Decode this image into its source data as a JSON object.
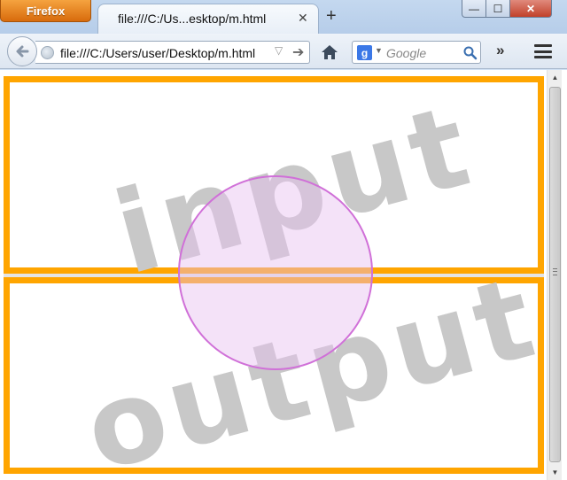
{
  "window": {
    "app_button_label": "Firefox",
    "tab_title": "file:///C:/Us...esktop/m.html",
    "tab_close_icon": "close-icon",
    "new_tab_label": "+",
    "controls": {
      "minimize": "—",
      "maximize": "☐",
      "close": "✕"
    }
  },
  "toolbar": {
    "back_icon": "back-arrow-icon",
    "url": "file:///C:/Users/user/Desktop/m.html",
    "home_icon": "home-icon",
    "search_engine": "g",
    "search_placeholder": "Google",
    "overflow_label": "»",
    "menu_icon": "hamburger-menu-icon"
  },
  "page": {
    "top_frame_watermark": "input",
    "bottom_frame_watermark": "output",
    "frame_color": "#ffa500",
    "circle_stroke_color": "#d070d8",
    "circle_fill_color": "#f0dcf5"
  }
}
